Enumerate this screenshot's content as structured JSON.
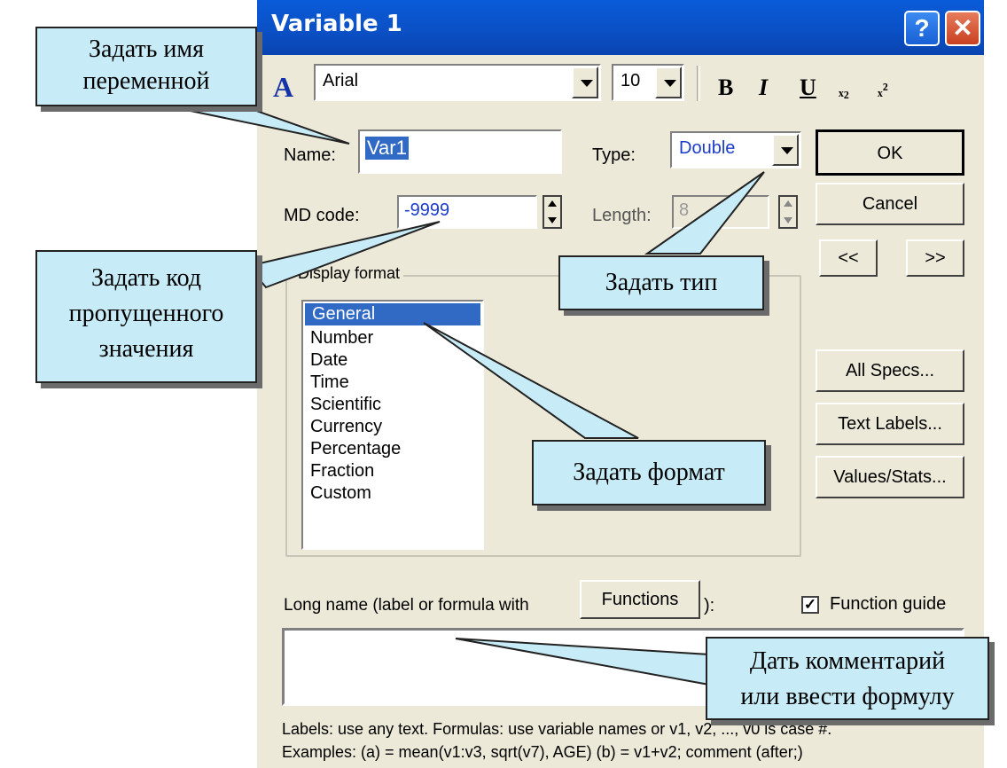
{
  "window": {
    "title": "Variable 1"
  },
  "toolbar": {
    "font": "Arial",
    "size": "10",
    "bold": "B",
    "italic": "I",
    "underline": "U",
    "subscript": "ₓ₂",
    "superscript": "ₓ²"
  },
  "form": {
    "name_label": "Name:",
    "name_value": "Var1",
    "type_label": "Type:",
    "type_value": "Double",
    "md_label": "MD code:",
    "md_value": "-9999",
    "length_label": "Length:",
    "length_value": "8",
    "display_format_label": "Display format",
    "formats": [
      "General",
      "Number",
      "Date",
      "Time",
      "Scientific",
      "Currency",
      "Percentage",
      "Fraction",
      "Custom"
    ],
    "long_name_label": "Long name (label or formula with",
    "long_name_suffix": "):",
    "functions_button": "Functions",
    "function_guide_label": "Function guide",
    "hint_line1": "Labels: use any text.  Formulas: use variable names or v1, v2, ..., v0 is case #.",
    "hint_line2": "Examples:   (a) = mean(v1:v3, sqrt(v7), AGE)   (b) = v1+v2; comment (after;)"
  },
  "buttons": {
    "ok": "OK",
    "cancel": "Cancel",
    "prev": "<<",
    "next": ">>",
    "all_specs": "All Specs...",
    "text_labels": "Text Labels...",
    "values_stats": "Values/Stats..."
  },
  "callouts": {
    "name": [
      "Задать имя",
      "переменной"
    ],
    "md": [
      "Задать код",
      "пропущенного",
      "значения"
    ],
    "type": "Задать тип",
    "format": "Задать формат",
    "comment": [
      "Дать комментарий",
      "или ввести формулу"
    ]
  },
  "colors": {
    "title_bar": "#0b4fc4",
    "callout_fill": "#c7ecf7",
    "selection": "#316ac5"
  }
}
